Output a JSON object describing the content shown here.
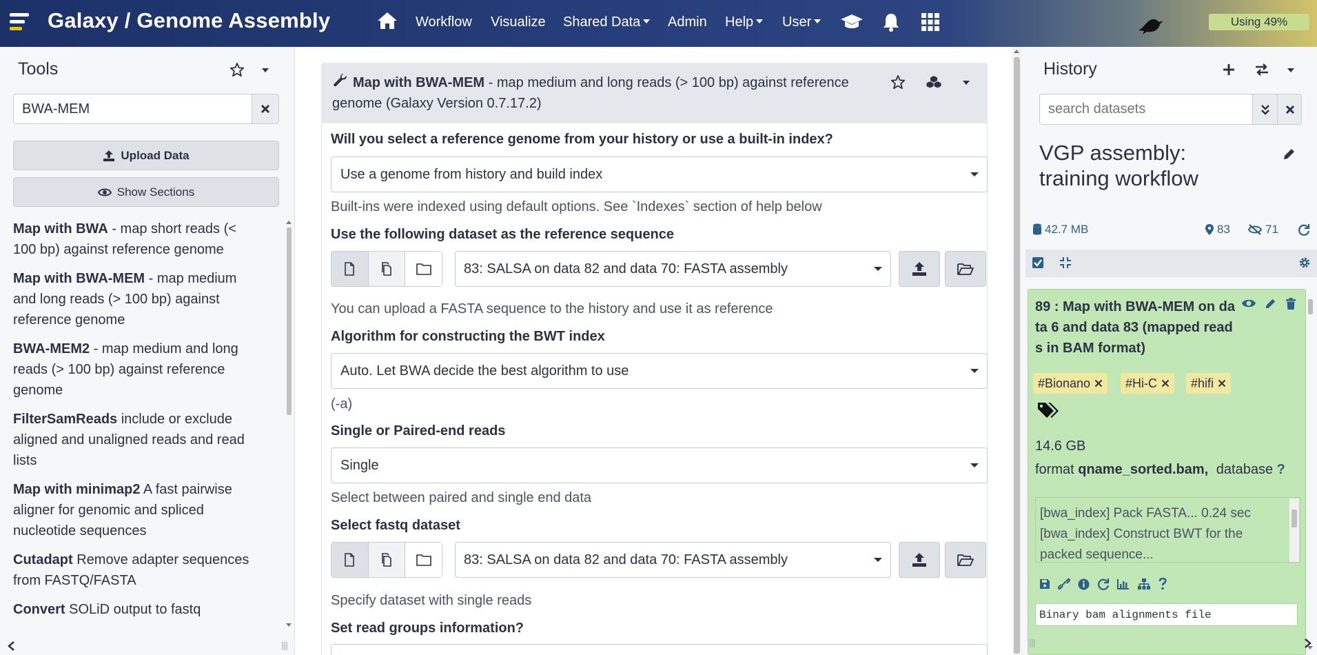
{
  "masthead": {
    "brand": "Galaxy / Genome Assembly",
    "nav": {
      "workflow": "Workflow",
      "visualize": "Visualize",
      "shared_data": "Shared Data",
      "admin": "Admin",
      "help": "Help",
      "user": "User"
    },
    "quota_label": "Using 49%",
    "quota_percent": 49
  },
  "tool_panel": {
    "title": "Tools",
    "search_value": "BWA-MEM",
    "upload_label": "Upload Data",
    "sections_label": "Show Sections",
    "tools": [
      {
        "name": "Map with BWA",
        "desc": " - map short reads (< 100 bp) against reference genome"
      },
      {
        "name": "Map with BWA-MEM",
        "desc": " - map medium and long reads (> 100 bp) against reference genome"
      },
      {
        "name": "BWA-MEM2",
        "desc": " - map medium and long reads (> 100 bp) against reference genome"
      },
      {
        "name": "FilterSamReads",
        "desc": " include or exclude aligned and unaligned reads and read lists"
      },
      {
        "name": "Map with minimap2",
        "desc": " A fast pairwise aligner for genomic and spliced nucleotide sequences"
      },
      {
        "name": "Cutadapt",
        "desc": " Remove adapter sequences from FASTQ/FASTA"
      },
      {
        "name": "Convert",
        "desc": " SOLiD output to fastq"
      }
    ]
  },
  "tool_form": {
    "tool_name": "Map with BWA-MEM",
    "tool_desc": " - map medium and long reads (> 100 bp) against reference genome (Galaxy Version 0.7.17.2)",
    "q1_label": "Will you select a reference genome from your history or use a built-in index?",
    "q1_value": "Use a genome from history and build index",
    "q1_help": "Built-ins were indexed using default options. See `Indexes` section of help below",
    "q2_label": "Use the following dataset as the reference sequence",
    "q2_value": "83: SALSA on data 82 and data 70: FASTA assembly",
    "q2_help": "You can upload a FASTA sequence to the history and use it as reference",
    "q3_label": "Algorithm for constructing the BWT index",
    "q3_value": "Auto. Let BWA decide the best algorithm to use",
    "q3_help": "(-a)",
    "q4_label": "Single or Paired-end reads",
    "q4_value": "Single",
    "q4_help": "Select between paired and single end data",
    "q5_label": "Select fastq dataset",
    "q5_value": "83: SALSA on data 82 and data 70: FASTA assembly",
    "q5_help": "Specify dataset with single reads",
    "q6_label": "Set read groups information?"
  },
  "history": {
    "title": "History",
    "search_placeholder": "search datasets",
    "name": "VGP assembly: training workflow",
    "size": "42.7 MB",
    "shown_count": "83",
    "hidden_count": "71",
    "dataset": {
      "title": "89 : Map with BWA-MEM on data 6 and data 83 (mapped reads in BAM format)",
      "tags": [
        "#Bionano",
        "#Hi-C",
        "#hifi"
      ],
      "file_size": "14.6 GB",
      "format_label": "format",
      "format_value": "qname_sorted.bam,",
      "database_label": "database",
      "database_value": "?",
      "peek": "[bwa_index] Pack FASTA... 0.24 sec [bwa_index] Construct BWT for the packed sequence...",
      "info": "Binary bam alignments file"
    }
  }
}
